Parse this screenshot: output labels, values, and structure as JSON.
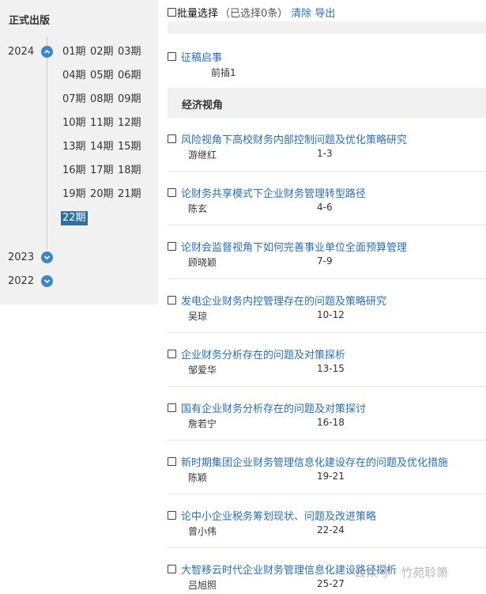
{
  "sidebar": {
    "title": "正式出版",
    "years": [
      {
        "label": "2024",
        "expanded": true
      },
      {
        "label": "2023",
        "expanded": false
      },
      {
        "label": "2022",
        "expanded": false
      }
    ],
    "issues": [
      "01期",
      "02期",
      "03期",
      "04期",
      "05期",
      "06期",
      "07期",
      "08期",
      "09期",
      "10期",
      "11期",
      "12期",
      "13期",
      "14期",
      "15期",
      "16期",
      "17期",
      "18期",
      "19期",
      "20期",
      "21期",
      "22期"
    ],
    "active_issue": "22期"
  },
  "toolbar": {
    "batch_label": "批量选择",
    "selected_count": "（已选择0条）",
    "clear": "清除",
    "export": "导出"
  },
  "front": {
    "title": "征稿启事",
    "pages": "前插1"
  },
  "section": "经济视角",
  "articles": [
    {
      "title": "风险视角下高校财务内部控制问题及优化策略研究",
      "author": "游继红",
      "pages": "1-3"
    },
    {
      "title": "论财务共享模式下企业财务管理转型路径",
      "author": "陈玄",
      "pages": "4-6"
    },
    {
      "title": "论财会监督视角下如何完善事业单位全面预算管理",
      "author": "顾晓颖",
      "pages": "7-9"
    },
    {
      "title": "发电企业财务内控管理存在的问题及策略研究",
      "author": "吴琼",
      "pages": "10-12"
    },
    {
      "title": "企业财务分析存在的问题及对策探析",
      "author": "邹爱华",
      "pages": "13-15"
    },
    {
      "title": "国有企业财务分析存在的问题及对策探讨",
      "author": "詹若宁",
      "pages": "16-18"
    },
    {
      "title": "新时期集团企业财务管理信息化建设存在的问题及优化措施",
      "author": "陈颖",
      "pages": "19-21"
    },
    {
      "title": "论中小企业税务筹划现状、问题及改进策略",
      "author": "曾小伟",
      "pages": "22-24"
    },
    {
      "title": "大智移云时代企业财务管理信息化建设路径探析",
      "author": "吕旭照",
      "pages": "25-27"
    }
  ],
  "watermark": "公众号 · 竹苑聆箫",
  "colors": {
    "link": "#2a6fb0",
    "accent": "#3a86c8",
    "active": "#2e6ea6",
    "panel": "#f1f1f1"
  }
}
